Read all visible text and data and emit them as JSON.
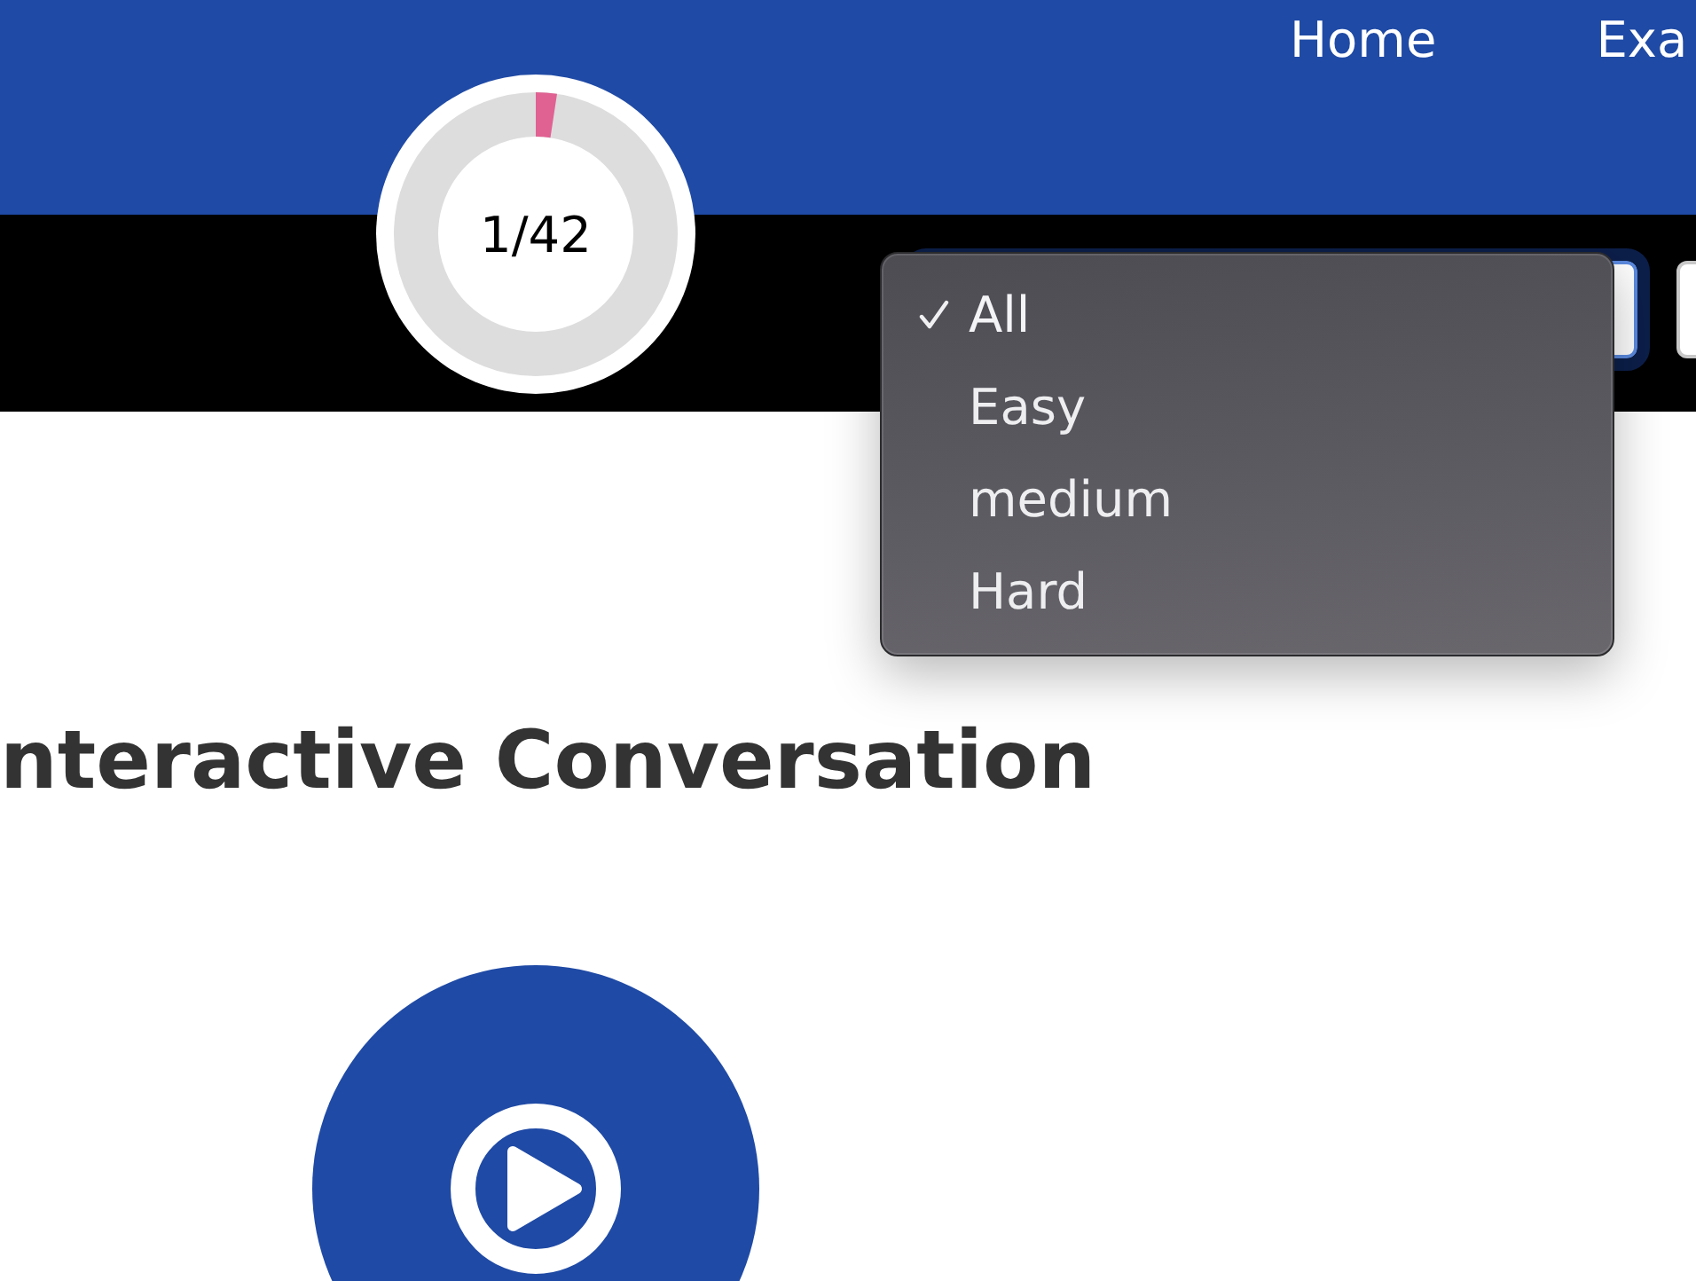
{
  "nav": {
    "links": [
      {
        "label": "Home"
      },
      {
        "label": "Exa"
      }
    ]
  },
  "progress": {
    "label": "1/42",
    "level": 0.024
  },
  "filter_menu": {
    "options": [
      {
        "label": "All",
        "selected": true
      },
      {
        "label": "Easy",
        "selected": false
      },
      {
        "label": "medium",
        "selected": false
      },
      {
        "label": "Hard",
        "selected": false
      }
    ]
  },
  "heading": "nteractive Conversation"
}
